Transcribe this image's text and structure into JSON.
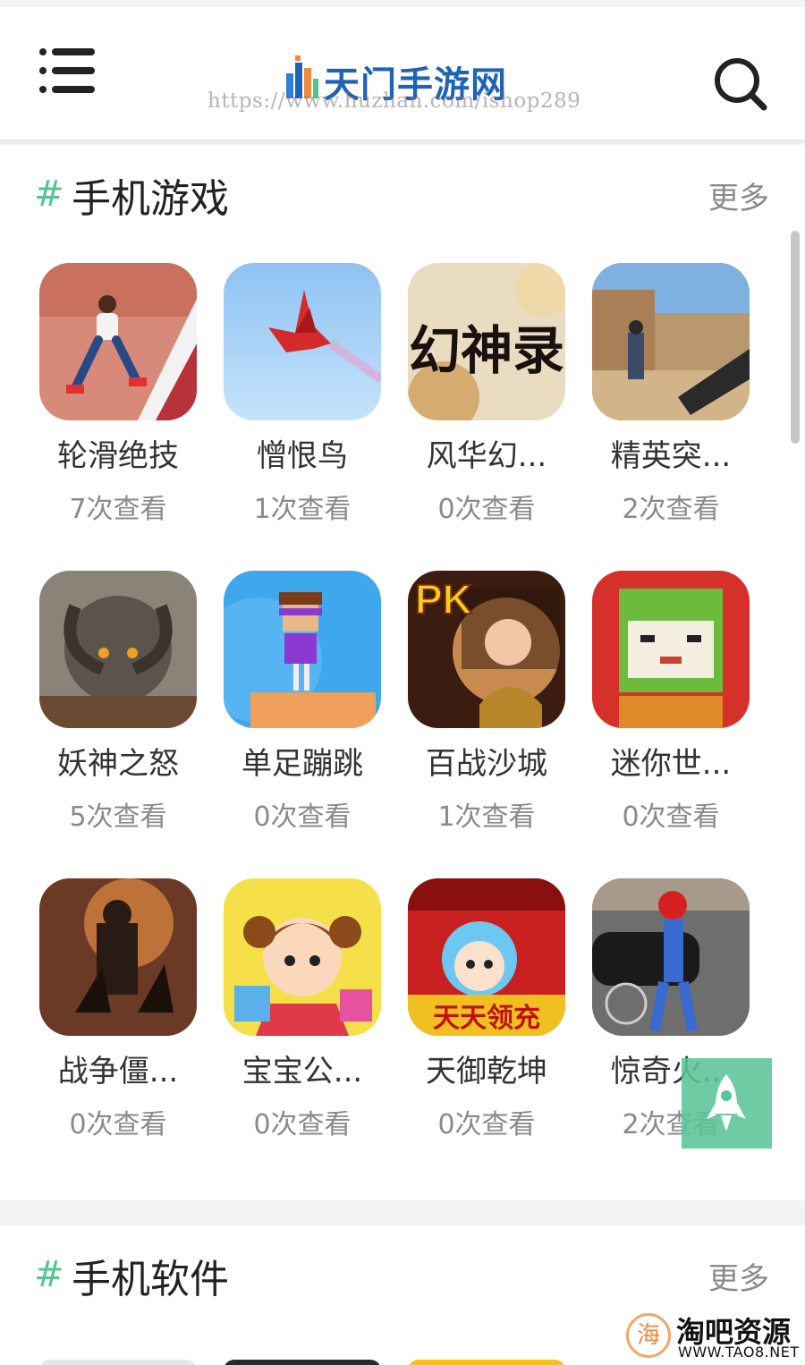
{
  "header": {
    "logo_text": "天门手游网",
    "watermark_url": "https://www.huzhan.com/ishop289",
    "menu_icon": "menu-icon",
    "search_icon": "search-icon"
  },
  "sections": {
    "games": {
      "hash": "#",
      "title": "手机游戏",
      "more": "更多",
      "items": [
        {
          "name": "轮滑绝技",
          "views": "7次查看"
        },
        {
          "name": "憎恨鸟",
          "views": "1次查看"
        },
        {
          "name": "风华幻...",
          "views": "0次查看",
          "icon_text": "幻神录"
        },
        {
          "name": "精英突...",
          "views": "2次查看"
        },
        {
          "name": "妖神之怒",
          "views": "5次查看"
        },
        {
          "name": "单足蹦跳",
          "views": "0次查看"
        },
        {
          "name": "百战沙城",
          "views": "1次查看",
          "icon_text": "PK"
        },
        {
          "name": "迷你世...",
          "views": "0次查看"
        },
        {
          "name": "战争僵...",
          "views": "0次查看"
        },
        {
          "name": "宝宝公...",
          "views": "0次查看"
        },
        {
          "name": "天御乾坤",
          "views": "0次查看",
          "icon_text": "天天领充"
        },
        {
          "name": "惊奇火...",
          "views": "2次查看"
        }
      ]
    },
    "apps": {
      "hash": "#",
      "title": "手机软件",
      "more": "更多"
    }
  },
  "back_to_top_icon": "rocket-icon",
  "corner_watermark": {
    "circle_char": "海",
    "title": "淘吧资源",
    "url": "WWW.TAO8.NET"
  },
  "colors": {
    "accent": "#4fc58f",
    "logo_blue": "#1e63b6",
    "muted_text": "#8a8a8a"
  }
}
